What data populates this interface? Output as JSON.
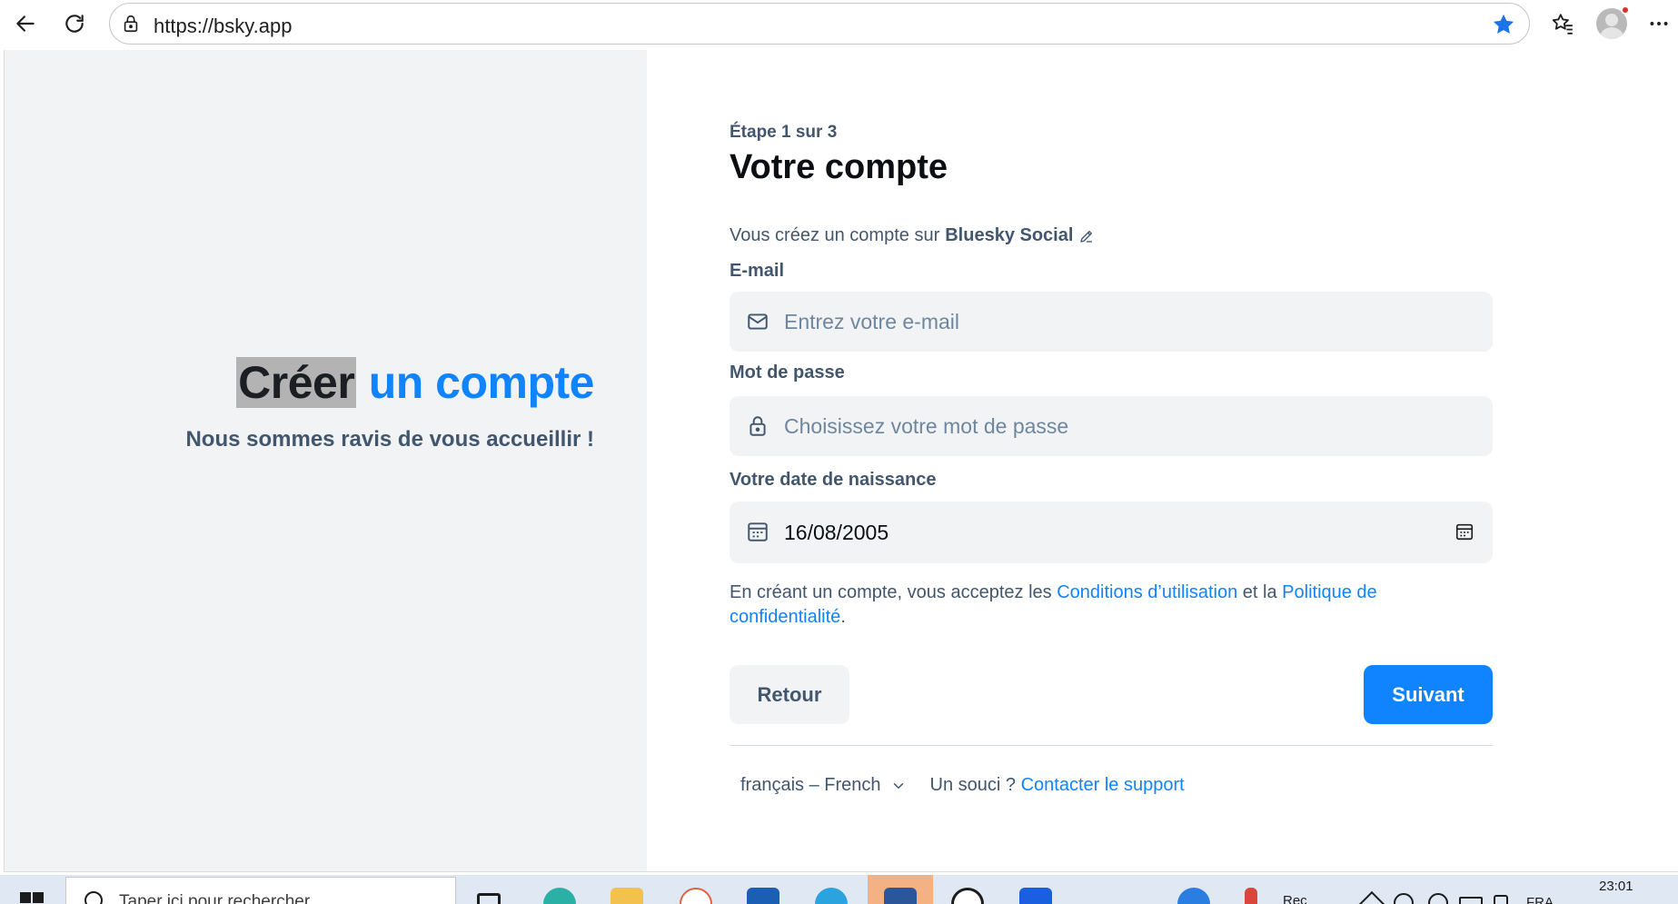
{
  "browser": {
    "url": "https://bsky.app"
  },
  "hero": {
    "title_part1": "Créer",
    "title_part2": "un compte",
    "subtitle": "Nous sommes ravis de vous accueillir !"
  },
  "form": {
    "step": "Étape 1 sur 3",
    "heading": "Votre compte",
    "service_prefix": "Vous créez un compte sur",
    "service_name": "Bluesky Social",
    "email": {
      "label": "E-mail",
      "placeholder": "Entrez votre e-mail"
    },
    "password": {
      "label": "Mot de passe",
      "placeholder": "Choisissez votre mot de passe"
    },
    "birthdate": {
      "label": "Votre date de naissance",
      "value": "16/08/2005"
    },
    "terms": {
      "prefix": "En créant un compte, vous acceptez les",
      "terms_link": "Conditions d’utilisation",
      "middle": "et la",
      "privacy_link": "Politique de confidentialité",
      "suffix": "."
    },
    "back_label": "Retour",
    "next_label": "Suivant"
  },
  "footer": {
    "language": "français – French",
    "help_prefix": "Un souci ?",
    "help_link": "Contacter le support"
  },
  "taskbar": {
    "search_placeholder": "Taper ici pour rechercher",
    "app_label": "Rec",
    "language": "FRA",
    "time": "23:01"
  },
  "colors": {
    "accent": "#1083fe",
    "text_muted": "#42566e",
    "field_bg": "#f1f3f5"
  }
}
